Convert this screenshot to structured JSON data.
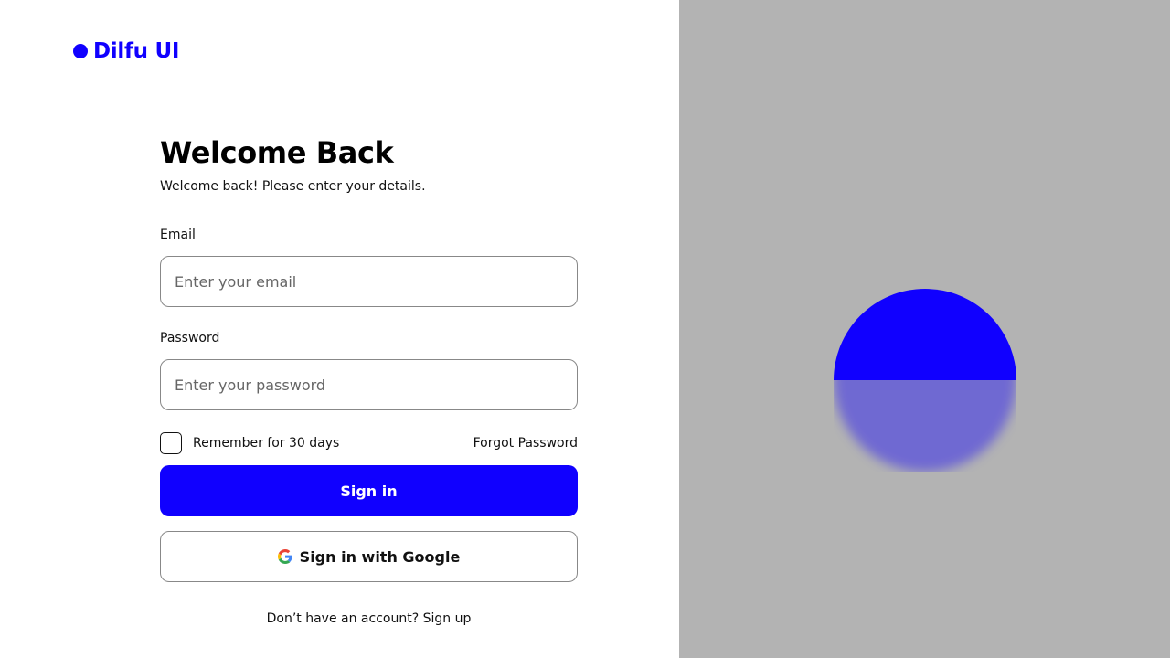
{
  "brand": {
    "name": "Dilfu UI",
    "color": "#1000ff"
  },
  "form": {
    "title": "Welcome Back",
    "subtitle": "Welcome back! Please enter your details.",
    "email": {
      "label": "Email",
      "placeholder": "Enter your email",
      "value": ""
    },
    "password": {
      "label": "Password",
      "placeholder": "Enter your password",
      "value": ""
    },
    "remember_label": "Remember for 30 days",
    "remember_checked": false,
    "forgot_label": "Forgot Password",
    "signin_label": "Sign in",
    "google_label": "Sign in with Google",
    "google_icon": "google-icon",
    "signup_prompt": "Don’t have an account?",
    "signup_link": "Sign up"
  },
  "colors": {
    "accent": "#1000ff",
    "panel_background": "#b3b3b3"
  }
}
